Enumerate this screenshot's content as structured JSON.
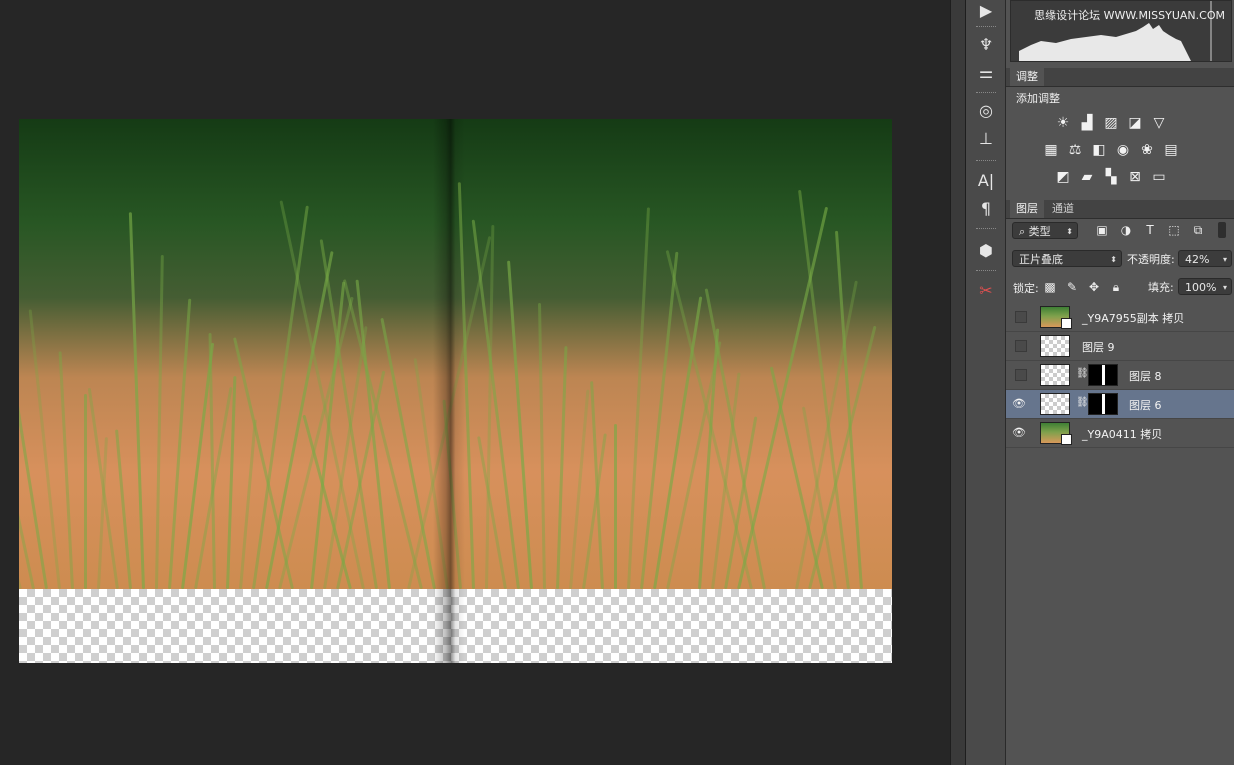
{
  "histogram": {
    "watermark": "思缘设计论坛 WWW.MISSYUAN.COM"
  },
  "adjustments": {
    "tab_label": "调整",
    "title": "添加调整",
    "row1": [
      "sun-icon",
      "levels-icon",
      "curves-icon",
      "exposure-icon",
      "vibrance-icon"
    ],
    "row2": [
      "hue-saturation-icon",
      "color-balance-icon",
      "black-white-icon",
      "photo-filter-icon",
      "channel-mixer-icon",
      "color-lookup-icon"
    ],
    "row3": [
      "invert-icon",
      "posterize-icon",
      "threshold-icon",
      "selective-color-icon",
      "gradient-map-icon"
    ]
  },
  "layers_panel": {
    "tabs": [
      "图层",
      "通道"
    ],
    "filter_kind": "类型",
    "blend_mode": "正片叠底",
    "opacity_label": "不透明度:",
    "opacity_value": "42%",
    "lock_label": "锁定:",
    "fill_label": "填充:",
    "fill_value": "100%",
    "layers": [
      {
        "name": "_Y9A7955副本 拷贝",
        "visible": false,
        "thumb": "photo",
        "mask": false,
        "selected": false
      },
      {
        "name": "图层 9",
        "visible": false,
        "thumb": "transparent",
        "mask": false,
        "selected": false
      },
      {
        "name": "图层 8",
        "visible": false,
        "thumb": "transparent",
        "mask": true,
        "selected": false
      },
      {
        "name": "图层 6",
        "visible": true,
        "thumb": "transparent",
        "mask": true,
        "selected": true
      },
      {
        "name": "_Y9A0411 拷贝",
        "visible": true,
        "thumb": "photo",
        "mask": false,
        "selected": false
      }
    ]
  },
  "colors": {
    "selected_row": "#66758d",
    "panel": "#535353",
    "canvas_bg": "#262626"
  }
}
